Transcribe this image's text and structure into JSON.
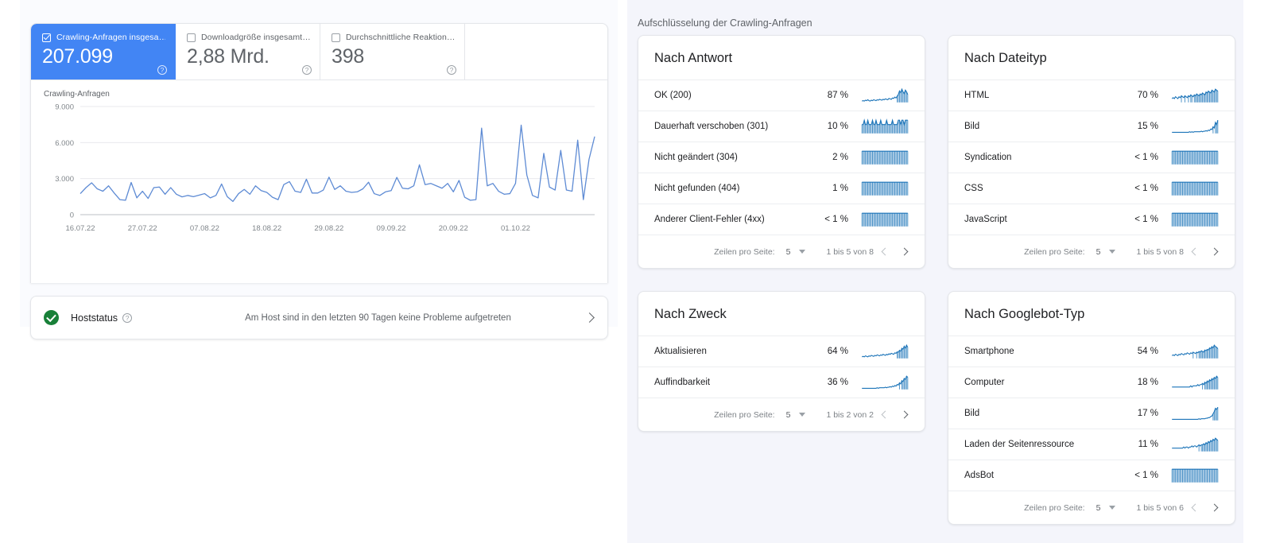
{
  "left": {
    "metrics": [
      {
        "label": "Crawling-Anfragen insgesa…",
        "value": "207.099",
        "selected": true,
        "help_icon": "question-mark-icon"
      },
      {
        "label": "Downloadgröße insgesamt…",
        "value": "2,88 Mrd.",
        "selected": false,
        "help_icon": "question-mark-icon"
      },
      {
        "label": "Durchschnittliche Reaktion…",
        "value": "398",
        "selected": false,
        "help_icon": "question-mark-icon"
      }
    ],
    "host_status": {
      "label": "Hoststatus",
      "message": "Am Host sind in den letzten 90 Tagen keine Probleme aufgetreten",
      "status_icon": "check-circle-icon",
      "chevron_icon": "chevron-right-icon"
    }
  },
  "right": {
    "section_title": "Aufschlüsselung der Crawling-Anfragen",
    "cards": [
      {
        "title": "Nach Antwort",
        "rows": [
          {
            "name": "OK (200)",
            "pct": "87 %"
          },
          {
            "name": "Dauerhaft verschoben (301)",
            "pct": "10 %"
          },
          {
            "name": "Nicht geändert (304)",
            "pct": "2 %"
          },
          {
            "name": "Nicht gefunden (404)",
            "pct": "1 %"
          },
          {
            "name": "Anderer Client-Fehler (4xx)",
            "pct": "< 1 %"
          }
        ],
        "footer": {
          "rows_per_page_label": "Zeilen pro Seite:",
          "rows_per_page_value": "5",
          "range": "1 bis 5 von 8",
          "prev_icon": "chevron-left-icon",
          "next_icon": "chevron-right-icon"
        }
      },
      {
        "title": "Nach Dateityp",
        "rows": [
          {
            "name": "HTML",
            "pct": "70 %"
          },
          {
            "name": "Bild",
            "pct": "15 %"
          },
          {
            "name": "Syndication",
            "pct": "< 1 %"
          },
          {
            "name": "CSS",
            "pct": "< 1 %"
          },
          {
            "name": "JavaScript",
            "pct": "< 1 %"
          }
        ],
        "footer": {
          "rows_per_page_label": "Zeilen pro Seite:",
          "rows_per_page_value": "5",
          "range": "1 bis 5 von 8",
          "prev_icon": "chevron-left-icon",
          "next_icon": "chevron-right-icon"
        }
      },
      {
        "title": "Nach Zweck",
        "rows": [
          {
            "name": "Aktualisieren",
            "pct": "64 %"
          },
          {
            "name": "Auffindbarkeit",
            "pct": "36 %"
          }
        ],
        "footer": {
          "rows_per_page_label": "Zeilen pro Seite:",
          "rows_per_page_value": "5",
          "range": "1 bis 2 von 2",
          "prev_icon": "chevron-left-icon",
          "next_icon": "chevron-right-icon"
        }
      },
      {
        "title": "Nach Googlebot-Typ",
        "rows": [
          {
            "name": "Smartphone",
            "pct": "54 %"
          },
          {
            "name": "Computer",
            "pct": "18 %"
          },
          {
            "name": "Bild",
            "pct": "17 %"
          },
          {
            "name": "Laden der Seitenressource",
            "pct": "11 %"
          },
          {
            "name": "AdsBot",
            "pct": "< 1 %"
          }
        ],
        "footer": {
          "rows_per_page_label": "Zeilen pro Seite:",
          "rows_per_page_value": "5",
          "range": "1 bis 5 von 6",
          "prev_icon": "chevron-left-icon",
          "next_icon": "chevron-right-icon"
        }
      }
    ]
  },
  "colors": {
    "accent": "#4285f4",
    "line": "#5e8bd4",
    "spark": "#1a73b8",
    "ok_green": "#188038",
    "panel_bg": "#f4f5fb",
    "left_panel_bg": "#fafbfe"
  },
  "chart_data": {
    "type": "line",
    "title": "Crawling-Anfragen",
    "xlabel": "",
    "ylabel": "Crawling-Anfragen",
    "ylim": [
      0,
      9000
    ],
    "yticks": [
      0,
      3000,
      6000,
      9000
    ],
    "ytick_labels": [
      "0",
      "3.000",
      "6.000",
      "9.000"
    ],
    "xtick_labels": [
      "16.07.22",
      "27.07.22",
      "07.08.22",
      "18.08.22",
      "29.08.22",
      "09.09.22",
      "20.09.22",
      "01.10.22"
    ],
    "xtick_indices": [
      0,
      11,
      22,
      33,
      44,
      55,
      66,
      77
    ],
    "grid": true,
    "series": [
      {
        "name": "Crawling-Anfragen",
        "color": "#5e8bd4",
        "values": [
          1750,
          2250,
          2650,
          2150,
          1950,
          2400,
          1800,
          1250,
          1200,
          2680,
          1400,
          1950,
          1350,
          2250,
          2300,
          1700,
          2250,
          1700,
          1480,
          1600,
          1500,
          1620,
          1750,
          1400,
          1600,
          2550,
          1500,
          1100,
          1750,
          2100,
          1700,
          2400,
          2000,
          1850,
          1450,
          1250,
          2500,
          2750,
          1950,
          1850,
          2950,
          1800,
          1800,
          2050,
          3120,
          2100,
          2400,
          1950,
          1850,
          1900,
          2150,
          2700,
          1750,
          1600,
          1900,
          2000,
          3100,
          2200,
          2150,
          2400,
          4150,
          2500,
          2600,
          2400,
          2200,
          2600,
          1900,
          2850,
          1450,
          1200,
          1250,
          7200,
          2400,
          2600,
          1950,
          1700,
          1750,
          2600,
          7450,
          3300,
          1600,
          1400,
          5100,
          2300,
          2050,
          5350,
          2050,
          1950,
          6200,
          1250,
          4600,
          6500
        ]
      }
    ]
  },
  "sparklines": {
    "antwort": [
      [
        3,
        4,
        3,
        5,
        4,
        6,
        4,
        3,
        5,
        4,
        6,
        5,
        4,
        6,
        5,
        7,
        6,
        5,
        7,
        6,
        8,
        7,
        6,
        9,
        8,
        7,
        10,
        9,
        12,
        10,
        14,
        18,
        26,
        22,
        30,
        24,
        20,
        28,
        24,
        18
      ],
      [
        2,
        2,
        3,
        2,
        2,
        3,
        2,
        2,
        2,
        3,
        2,
        2,
        3,
        2,
        2,
        2,
        3,
        2,
        2,
        2,
        2,
        3,
        2,
        2,
        2,
        2,
        3,
        2,
        2,
        2,
        2,
        3,
        3,
        2,
        3,
        3,
        2,
        3,
        3,
        3
      ],
      [
        1,
        1,
        1,
        1,
        1,
        1,
        1,
        1,
        1,
        1,
        1,
        1,
        1,
        1,
        1,
        1,
        1,
        1,
        1,
        1,
        1,
        1,
        1,
        1,
        1,
        1,
        1,
        1,
        1,
        1,
        1,
        1,
        1,
        1,
        1,
        1,
        1,
        1,
        1,
        1
      ],
      [
        1,
        1,
        1,
        1,
        1,
        1,
        1,
        1,
        1,
        1,
        1,
        1,
        1,
        1,
        1,
        1,
        1,
        1,
        1,
        1,
        1,
        1,
        1,
        1,
        1,
        1,
        1,
        1,
        1,
        1,
        1,
        1,
        1,
        1,
        1,
        1,
        1,
        1,
        1,
        1
      ],
      [
        1,
        1,
        1,
        1,
        1,
        1,
        1,
        1,
        1,
        1,
        1,
        1,
        1,
        1,
        1,
        1,
        1,
        1,
        1,
        1,
        1,
        1,
        1,
        1,
        1,
        1,
        1,
        1,
        1,
        1,
        1,
        1,
        1,
        1,
        1,
        1,
        1,
        1,
        1,
        1
      ]
    ],
    "dateityp": [
      [
        4,
        5,
        4,
        6,
        5,
        4,
        6,
        5,
        7,
        6,
        5,
        7,
        6,
        5,
        7,
        6,
        8,
        7,
        6,
        8,
        7,
        9,
        8,
        7,
        9,
        8,
        10,
        9,
        8,
        11,
        10,
        12,
        11,
        10,
        13,
        12,
        11,
        14,
        13,
        12
      ],
      [
        2,
        2,
        2,
        2,
        2,
        2,
        2,
        2,
        2,
        2,
        2,
        2,
        2,
        2,
        2,
        3,
        2,
        3,
        2,
        3,
        3,
        3,
        3,
        3,
        3,
        4,
        3,
        4,
        4,
        5,
        4,
        6,
        5,
        8,
        7,
        12,
        10,
        20,
        16,
        24
      ],
      [
        1,
        1,
        1,
        1,
        1,
        1,
        1,
        1,
        1,
        1,
        1,
        1,
        1,
        1,
        1,
        1,
        1,
        1,
        1,
        1,
        1,
        1,
        1,
        1,
        1,
        1,
        1,
        1,
        1,
        1,
        1,
        1,
        1,
        1,
        1,
        1,
        1,
        1,
        1,
        1
      ],
      [
        1,
        1,
        1,
        1,
        1,
        1,
        1,
        1,
        1,
        1,
        1,
        1,
        1,
        1,
        1,
        1,
        1,
        1,
        1,
        1,
        1,
        1,
        1,
        1,
        1,
        1,
        1,
        1,
        1,
        1,
        1,
        1,
        1,
        1,
        1,
        1,
        1,
        1,
        1,
        1
      ],
      [
        1,
        1,
        1,
        1,
        1,
        1,
        1,
        1,
        1,
        1,
        1,
        1,
        1,
        1,
        1,
        1,
        1,
        1,
        1,
        1,
        1,
        1,
        1,
        1,
        1,
        1,
        1,
        1,
        1,
        1,
        1,
        1,
        1,
        1,
        1,
        1,
        1,
        1,
        1,
        1
      ]
    ],
    "zweck": [
      [
        3,
        4,
        3,
        5,
        4,
        3,
        5,
        4,
        6,
        5,
        4,
        6,
        5,
        7,
        6,
        5,
        7,
        6,
        8,
        7,
        6,
        8,
        7,
        9,
        8,
        10,
        9,
        8,
        11,
        10,
        13,
        12,
        16,
        14,
        20,
        18,
        24,
        20,
        26,
        22
      ],
      [
        2,
        2,
        2,
        2,
        2,
        2,
        2,
        2,
        2,
        2,
        2,
        2,
        2,
        3,
        2,
        3,
        3,
        3,
        3,
        3,
        4,
        3,
        4,
        4,
        5,
        4,
        6,
        5,
        7,
        6,
        9,
        8,
        12,
        10,
        16,
        14,
        20,
        18,
        24,
        22
      ]
    ],
    "googlebot": [
      [
        4,
        5,
        4,
        6,
        5,
        4,
        6,
        5,
        7,
        6,
        5,
        7,
        6,
        8,
        7,
        6,
        8,
        7,
        9,
        8,
        7,
        9,
        8,
        10,
        9,
        11,
        10,
        9,
        12,
        11,
        13,
        12,
        15,
        14,
        17,
        15,
        19,
        17,
        16,
        14
      ],
      [
        2,
        2,
        2,
        2,
        2,
        2,
        2,
        2,
        2,
        2,
        2,
        2,
        2,
        2,
        2,
        2,
        3,
        2,
        3,
        3,
        3,
        3,
        4,
        3,
        4,
        4,
        5,
        4,
        6,
        5,
        7,
        6,
        8,
        7,
        9,
        8,
        10,
        9,
        11,
        10
      ],
      [
        2,
        2,
        2,
        2,
        2,
        2,
        2,
        2,
        2,
        2,
        2,
        2,
        2,
        2,
        2,
        2,
        2,
        2,
        2,
        2,
        2,
        2,
        2,
        3,
        2,
        3,
        3,
        3,
        3,
        4,
        4,
        5,
        5,
        7,
        8,
        12,
        16,
        22,
        20,
        24
      ],
      [
        3,
        3,
        3,
        3,
        3,
        3,
        3,
        3,
        3,
        3,
        4,
        3,
        4,
        4,
        3,
        4,
        4,
        5,
        4,
        5,
        5,
        4,
        5,
        6,
        5,
        6,
        6,
        7,
        6,
        8,
        7,
        9,
        8,
        10,
        9,
        11,
        10,
        12,
        11,
        10
      ],
      [
        1,
        1,
        1,
        1,
        1,
        1,
        1,
        1,
        1,
        1,
        1,
        1,
        1,
        1,
        1,
        1,
        1,
        1,
        1,
        1,
        1,
        1,
        1,
        1,
        1,
        1,
        1,
        1,
        1,
        1,
        1,
        1,
        1,
        1,
        1,
        1,
        1,
        1,
        1,
        1
      ]
    ]
  }
}
